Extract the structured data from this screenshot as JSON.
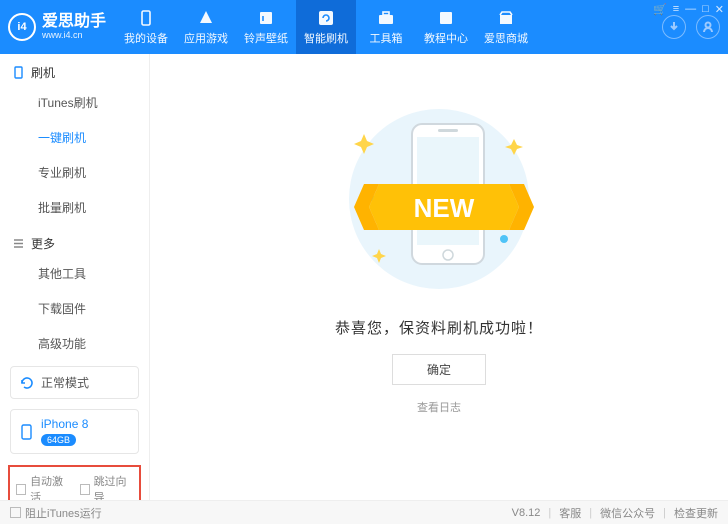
{
  "brand": {
    "name": "爱思助手",
    "url": "www.i4.cn",
    "logo_text": "i4"
  },
  "top_tabs": [
    {
      "label": "我的设备"
    },
    {
      "label": "应用游戏"
    },
    {
      "label": "铃声壁纸"
    },
    {
      "label": "智能刷机"
    },
    {
      "label": "工具箱"
    },
    {
      "label": "教程中心"
    },
    {
      "label": "爱思商城"
    }
  ],
  "sidebar": {
    "group1_title": "刷机",
    "group1_items": [
      "iTunes刷机",
      "一键刷机",
      "专业刷机",
      "批量刷机"
    ],
    "group2_title": "更多",
    "group2_items": [
      "其他工具",
      "下载固件",
      "高级功能"
    ],
    "mode_label": "正常模式",
    "device_name": "iPhone 8",
    "device_storage": "64GB",
    "auto_activate_label": "自动激活",
    "skip_guide_label": "跳过向导"
  },
  "main": {
    "banner_text": "NEW",
    "success_text": "恭喜您，保资料刷机成功啦！",
    "confirm_label": "确定",
    "view_log_label": "查看日志"
  },
  "footer": {
    "block_itunes_label": "阻止iTunes运行",
    "version": "V8.12",
    "links": [
      "客服",
      "微信公众号",
      "检查更新"
    ]
  }
}
